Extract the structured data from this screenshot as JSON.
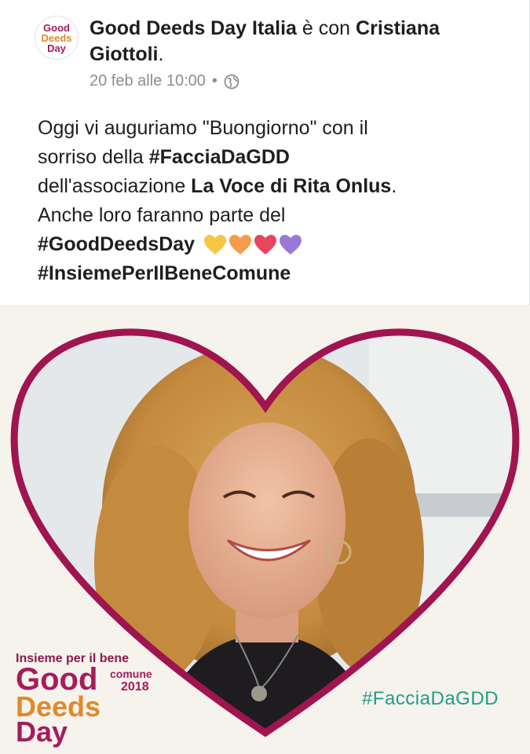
{
  "post": {
    "page_name": "Good Deeds Day Italia",
    "with_text": " è con ",
    "tagged_person": "Cristiana",
    "tagged_person_2": "Giottoli",
    "period": ".",
    "timestamp": "20 feb alle 10:00",
    "dot": "•",
    "audience_icon": "globe-icon",
    "avatar_logo": {
      "good": "Good",
      "deeds": "Deeds",
      "day": "Day"
    },
    "text": {
      "l1": "Oggi vi auguriamo \"Buongiorno\" con il",
      "l2a": "sorriso della ",
      "l2b": "#FacciaDaGDD",
      "l3a": "dell'associazione ",
      "l3b": "La Voce di Rita Onlus",
      "l3c": ".",
      "l4": "Anche loro faranno parte del",
      "l5": "#GoodDeedsDay",
      "l6": "#InsiemePerIlBeneComune"
    },
    "hearts": [
      {
        "color": "#f5c742",
        "icon": "yellow-heart-icon"
      },
      {
        "color": "#f49b4d",
        "icon": "orange-heart-icon"
      },
      {
        "color": "#e8455f",
        "icon": "red-heart-icon"
      },
      {
        "color": "#9a78d8",
        "icon": "purple-heart-icon"
      }
    ]
  },
  "photo": {
    "tagline": "Insieme per il bene",
    "comune": "comune",
    "year": "2018",
    "logo_good": "Good",
    "logo_deeds": "Deeds",
    "logo_day": "Day",
    "hashtag": "#FacciaDaGDD",
    "frame_color": "#a0144f"
  }
}
